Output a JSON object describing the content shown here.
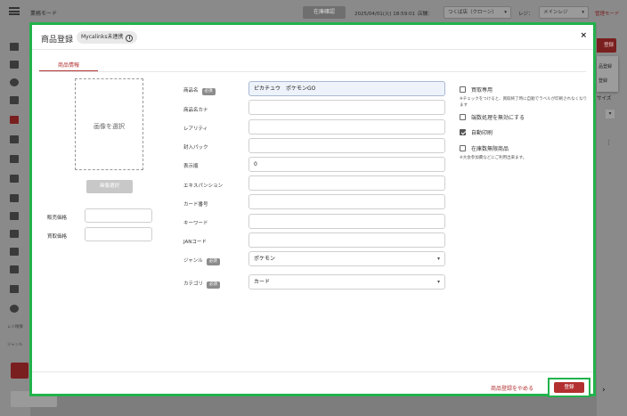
{
  "app": {
    "title": "業務モード",
    "top_button": "在庫確認",
    "datetime": "2025/04/01(火) 18:59:01",
    "store_label": "店舗：",
    "store_value": "つくば店（クローン）",
    "register_label": "レジ：",
    "register_value": "メインレジ",
    "mode_label": "管理モード",
    "nav_labels": [
      "レジ精算",
      "ジャンル"
    ],
    "right_button": "登録",
    "right_menu": [
      "品登録",
      "登録"
    ],
    "right_size_label": "サイズ"
  },
  "modal": {
    "title": "商品登録",
    "badge": "Mycalinks未連携",
    "info_icon_glyph": "i",
    "close_glyph": "×",
    "tab": "商品情報",
    "image_placeholder": "画像を選択",
    "image_button": "画像選択",
    "left_fields": [
      {
        "label": "販売価格",
        "value": ""
      },
      {
        "label": "買取価格",
        "value": ""
      }
    ],
    "required_badge": "必須",
    "fields": {
      "name": {
        "label": "商品名",
        "value": "ピカチュウ　ポケモンGO"
      },
      "kana": {
        "label": "商品名カナ",
        "value": ""
      },
      "rarity": {
        "label": "レアリティ",
        "value": ""
      },
      "pack": {
        "label": "封入パック",
        "value": ""
      },
      "order": {
        "label": "表示順",
        "value": "0"
      },
      "expansion": {
        "label": "エキスパンション",
        "value": ""
      },
      "card_no": {
        "label": "カード番号",
        "value": ""
      },
      "keyword": {
        "label": "キーワード",
        "value": ""
      },
      "jan": {
        "label": "JANコード",
        "value": ""
      },
      "genre": {
        "label": "ジャンル",
        "value": "ポケモン"
      },
      "category": {
        "label": "カテゴリ",
        "value": "カード"
      }
    },
    "options": [
      {
        "label": "買取専用",
        "checked": false,
        "note": "※チェックをつけると、買取終了時に自動でラベルが印刷されなくなります"
      },
      {
        "label": "端数処理を無効にする",
        "checked": false,
        "note": ""
      },
      {
        "label": "自動印刷",
        "checked": true,
        "note": ""
      },
      {
        "label": "在庫数無限商品",
        "checked": false,
        "note": "※大会参加費などにご利用出来ます。"
      }
    ],
    "cancel_label": "商品登録をやめる",
    "submit_label": "登録"
  }
}
